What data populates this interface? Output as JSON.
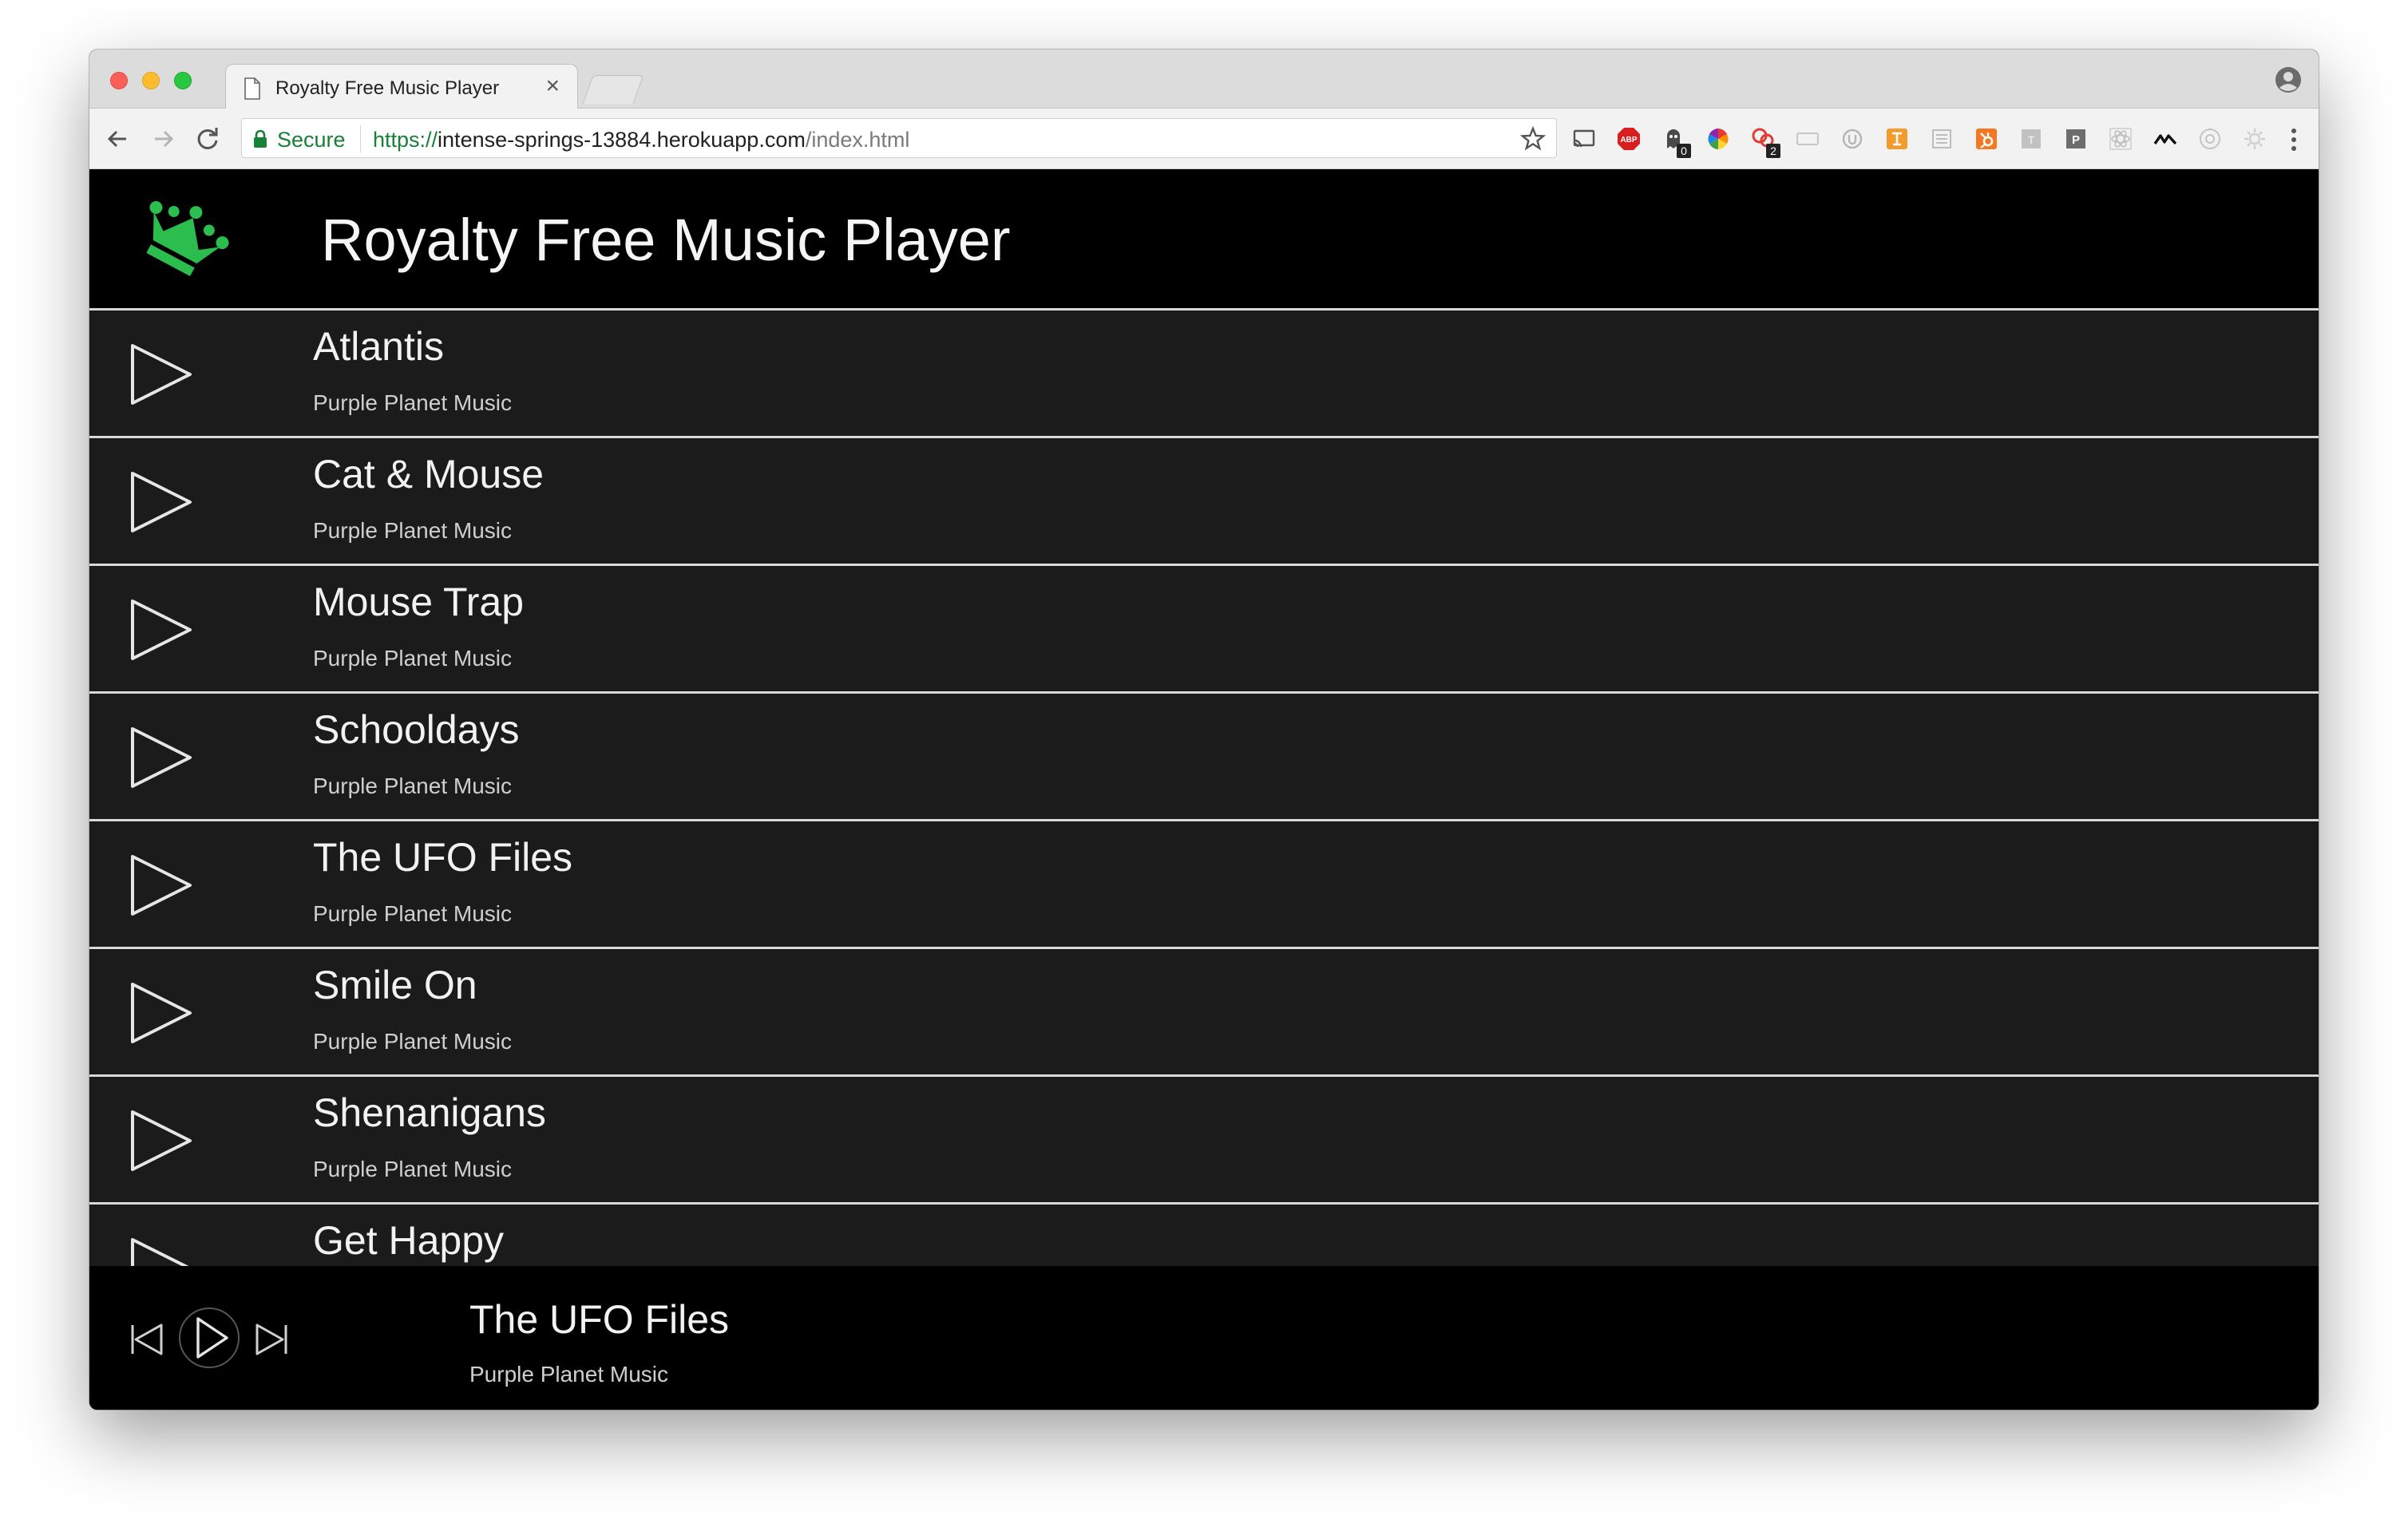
{
  "browser": {
    "tab_title": "Royalty Free Music Player",
    "tab_close": "×",
    "secure_label": "Secure",
    "url_scheme": "https://",
    "url_host": "intense-springs-13884.herokuapp.com",
    "url_path": "/index.html",
    "extension_badges": {
      "ghostery": "0",
      "pocket": "2"
    }
  },
  "app": {
    "title": "Royalty Free Music Player",
    "accent_color": "#2bbd4e",
    "tracks": [
      {
        "title": "Atlantis",
        "artist": "Purple Planet Music"
      },
      {
        "title": "Cat & Mouse",
        "artist": "Purple Planet Music"
      },
      {
        "title": "Mouse Trap",
        "artist": "Purple Planet Music"
      },
      {
        "title": "Schooldays",
        "artist": "Purple Planet Music"
      },
      {
        "title": "The UFO Files",
        "artist": "Purple Planet Music"
      },
      {
        "title": "Smile On",
        "artist": "Purple Planet Music"
      },
      {
        "title": "Shenanigans",
        "artist": "Purple Planet Music"
      },
      {
        "title": "Get Happy",
        "artist": ""
      }
    ],
    "now_playing": {
      "title": "The UFO Files",
      "artist": "Purple Planet Music"
    }
  }
}
